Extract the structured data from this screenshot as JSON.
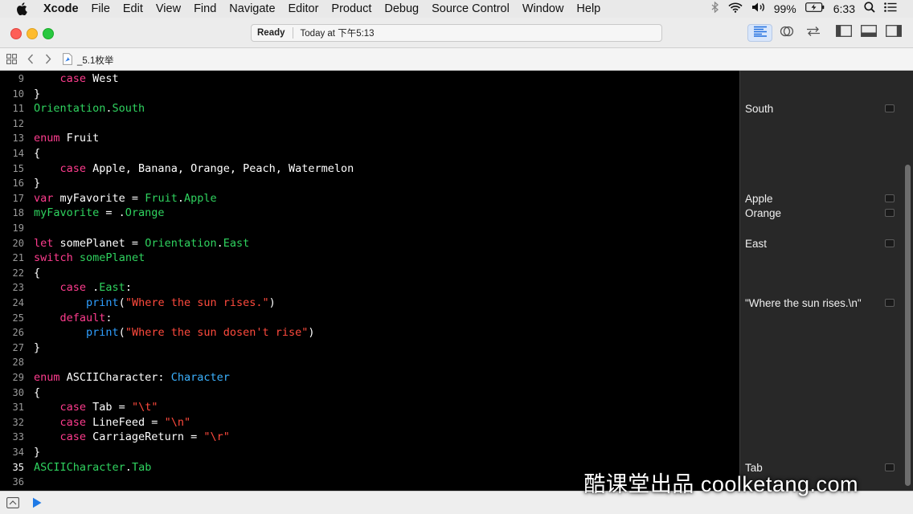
{
  "menubar": {
    "app_name": "Xcode",
    "items": [
      "File",
      "Edit",
      "View",
      "Find",
      "Navigate",
      "Editor",
      "Product",
      "Debug",
      "Source Control",
      "Window",
      "Help"
    ],
    "battery": "99%",
    "time": "6:33"
  },
  "toolbar": {
    "status": "Ready",
    "status_detail": "Today at 下午5:13"
  },
  "jumpbar": {
    "file_name": "_5.1枚举"
  },
  "editor": {
    "current_line": 35,
    "lines": [
      {
        "num": "9",
        "parts": [
          {
            "t": "    ",
            "c": "pl"
          },
          {
            "t": "case",
            "c": "kw"
          },
          {
            "t": " West",
            "c": "pl"
          }
        ]
      },
      {
        "num": "10",
        "parts": [
          {
            "t": "}",
            "c": "pl"
          }
        ]
      },
      {
        "num": "11",
        "parts": [
          {
            "t": "Orientation",
            "c": "ty"
          },
          {
            "t": ".",
            "c": "pl"
          },
          {
            "t": "South",
            "c": "id"
          }
        ]
      },
      {
        "num": "12",
        "parts": []
      },
      {
        "num": "13",
        "parts": [
          {
            "t": "enum",
            "c": "kw"
          },
          {
            "t": " Fruit",
            "c": "pl"
          }
        ]
      },
      {
        "num": "14",
        "parts": [
          {
            "t": "{",
            "c": "pl"
          }
        ]
      },
      {
        "num": "15",
        "parts": [
          {
            "t": "    ",
            "c": "pl"
          },
          {
            "t": "case",
            "c": "kw"
          },
          {
            "t": " Apple, Banana, Orange, Peach, Watermelon",
            "c": "pl"
          }
        ]
      },
      {
        "num": "16",
        "parts": [
          {
            "t": "}",
            "c": "pl"
          }
        ]
      },
      {
        "num": "17",
        "parts": [
          {
            "t": "var",
            "c": "kw"
          },
          {
            "t": " myFavorite = ",
            "c": "pl"
          },
          {
            "t": "Fruit",
            "c": "ty"
          },
          {
            "t": ".",
            "c": "pl"
          },
          {
            "t": "Apple",
            "c": "id"
          }
        ]
      },
      {
        "num": "18",
        "parts": [
          {
            "t": "myFavorite",
            "c": "id"
          },
          {
            "t": " = .",
            "c": "pl"
          },
          {
            "t": "Orange",
            "c": "id"
          }
        ]
      },
      {
        "num": "19",
        "parts": []
      },
      {
        "num": "20",
        "parts": [
          {
            "t": "let",
            "c": "kw"
          },
          {
            "t": " somePlanet = ",
            "c": "pl"
          },
          {
            "t": "Orientation",
            "c": "ty"
          },
          {
            "t": ".",
            "c": "pl"
          },
          {
            "t": "East",
            "c": "id"
          }
        ]
      },
      {
        "num": "21",
        "parts": [
          {
            "t": "switch",
            "c": "kw"
          },
          {
            "t": " ",
            "c": "pl"
          },
          {
            "t": "somePlanet",
            "c": "id"
          }
        ]
      },
      {
        "num": "22",
        "parts": [
          {
            "t": "{",
            "c": "pl"
          }
        ]
      },
      {
        "num": "23",
        "parts": [
          {
            "t": "    ",
            "c": "pl"
          },
          {
            "t": "case",
            "c": "kw"
          },
          {
            "t": " .",
            "c": "pl"
          },
          {
            "t": "East",
            "c": "id"
          },
          {
            "t": ":",
            "c": "pl"
          }
        ]
      },
      {
        "num": "24",
        "parts": [
          {
            "t": "        ",
            "c": "pl"
          },
          {
            "t": "print",
            "c": "fn"
          },
          {
            "t": "(",
            "c": "pl"
          },
          {
            "t": "\"Where the sun rises.\"",
            "c": "str"
          },
          {
            "t": ")",
            "c": "pl"
          }
        ]
      },
      {
        "num": "25",
        "parts": [
          {
            "t": "    ",
            "c": "pl"
          },
          {
            "t": "default",
            "c": "kw"
          },
          {
            "t": ":",
            "c": "pl"
          }
        ]
      },
      {
        "num": "26",
        "parts": [
          {
            "t": "        ",
            "c": "pl"
          },
          {
            "t": "print",
            "c": "fn"
          },
          {
            "t": "(",
            "c": "pl"
          },
          {
            "t": "\"Where the sun dosen't rise\"",
            "c": "str"
          },
          {
            "t": ")",
            "c": "pl"
          }
        ]
      },
      {
        "num": "27",
        "parts": [
          {
            "t": "}",
            "c": "pl"
          }
        ]
      },
      {
        "num": "28",
        "parts": []
      },
      {
        "num": "29",
        "parts": [
          {
            "t": "enum",
            "c": "kw"
          },
          {
            "t": " ASCIICharacter: ",
            "c": "pl"
          },
          {
            "t": "Character",
            "c": "sys"
          }
        ]
      },
      {
        "num": "30",
        "parts": [
          {
            "t": "{",
            "c": "pl"
          }
        ]
      },
      {
        "num": "31",
        "parts": [
          {
            "t": "    ",
            "c": "pl"
          },
          {
            "t": "case",
            "c": "kw"
          },
          {
            "t": " Tab = ",
            "c": "pl"
          },
          {
            "t": "\"\\t\"",
            "c": "str"
          }
        ]
      },
      {
        "num": "32",
        "parts": [
          {
            "t": "    ",
            "c": "pl"
          },
          {
            "t": "case",
            "c": "kw"
          },
          {
            "t": " LineFeed = ",
            "c": "pl"
          },
          {
            "t": "\"\\n\"",
            "c": "str"
          }
        ]
      },
      {
        "num": "33",
        "parts": [
          {
            "t": "    ",
            "c": "pl"
          },
          {
            "t": "case",
            "c": "kw"
          },
          {
            "t": " CarriageReturn = ",
            "c": "pl"
          },
          {
            "t": "\"\\r\"",
            "c": "str"
          }
        ]
      },
      {
        "num": "34",
        "parts": [
          {
            "t": "}",
            "c": "pl"
          }
        ]
      },
      {
        "num": "35",
        "parts": [
          {
            "t": "ASCIICharacter",
            "c": "ty"
          },
          {
            "t": ".",
            "c": "pl"
          },
          {
            "t": "Tab",
            "c": "id"
          }
        ]
      },
      {
        "num": "36",
        "parts": []
      }
    ]
  },
  "results": [
    {
      "line": "11",
      "text": "South"
    },
    {
      "line": "17",
      "text": "Apple"
    },
    {
      "line": "18",
      "text": "Orange"
    },
    {
      "line": "20",
      "text": "East"
    },
    {
      "line": "24",
      "text": "\"Where the sun rises.\\n\""
    },
    {
      "line": "35",
      "text": "Tab"
    }
  ],
  "watermark": "酷课堂出品 coolketang.com",
  "colors": {
    "keyword": "#ff3c8e",
    "type": "#2fd35f",
    "string": "#ff4a3d",
    "function": "#2f9fff"
  }
}
